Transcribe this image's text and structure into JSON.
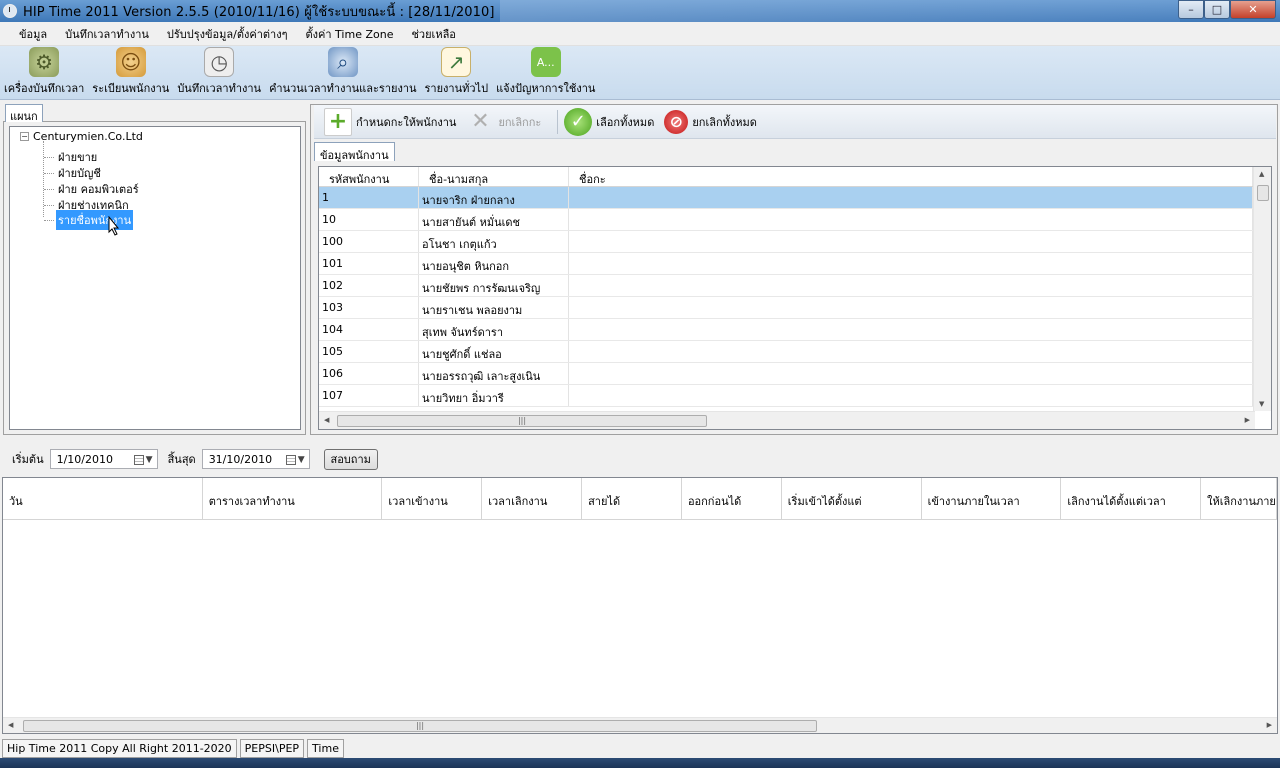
{
  "window": {
    "title": "HIP Time 2011 Version 2.5.5 (2010/11/16)   ผู้ใช้ระบบขณะนี้  :  [28/11/2010]",
    "controls": [
      "minimize",
      "maximize",
      "close"
    ]
  },
  "menu": [
    "ข้อมูล",
    "บันทึกเวลาทำงาน",
    "ปรับปรุงข้อมูล/ตั้งค่าต่างๆ",
    "ตั้งค่า Time Zone",
    "ช่วยเหลือ"
  ],
  "toolbar": [
    {
      "label": "เครื่องบันทึกเวลา",
      "icon": "gears-icon",
      "color": "#8a9b5a"
    },
    {
      "label": "ระเบียนพนักงาน",
      "icon": "users-icon",
      "color": "#d49a3a"
    },
    {
      "label": "บันทึกเวลาทำงาน",
      "icon": "calendar-clock-icon",
      "color": "#c9c9c9"
    },
    {
      "label": "คำนวนเวลาทำงานและรายงาน",
      "icon": "magnifier-icon",
      "color": "#6f95c4"
    },
    {
      "label": "รายงานทั่วไป",
      "icon": "chart-report-icon",
      "color": "#d9c27a"
    },
    {
      "label": "แจ้งปัญหาการใช้งาน",
      "icon": "chat-bubble-icon",
      "color": "#7cc24a"
    }
  ],
  "left_panel": {
    "tab": "แผนก",
    "root": "Centurymien.Co.Ltd",
    "children": [
      "ฝ่ายขาย",
      "ฝ่ายบัญชี",
      "ฝ่าย คอมพิวเตอร์",
      "ฝ่ายช่างเทคนิก",
      "รายชื่อพนักงาน"
    ],
    "selected": "รายชื่อพนักงาน"
  },
  "actions": {
    "assign": "กำหนดกะให้พนักงาน",
    "cancel_shift": "ยกเลิกกะ",
    "select_all": "เลือกทั้งหมด",
    "deselect_all": "ยกเลิกทั้งหมด"
  },
  "employee_tab": "ข้อมูลพนักงาน",
  "employee_grid": {
    "columns": [
      "รหัสพนักงาน",
      "ชื่อ-นามสกุล",
      "ชื่อกะ"
    ],
    "rows": [
      [
        "1",
        "นายจาริก ฝ่ายกลาง",
        ""
      ],
      [
        "10",
        "นายสายันต์ หมั่นเดช",
        ""
      ],
      [
        "100",
        "อโนชา เกตุแก้ว",
        ""
      ],
      [
        "101",
        "นายอนุชิต หินกอก",
        ""
      ],
      [
        "102",
        "นายชัยพร การรัฒนเจริญ",
        ""
      ],
      [
        "103",
        "นายราเชน พลอยงาม",
        ""
      ],
      [
        "104",
        "สุเทพ จันทร์ดารา",
        ""
      ],
      [
        "105",
        "นายชูศักดิ์ แช่ลอ",
        ""
      ],
      [
        "106",
        "นายอรรถวุฒิ เลาะสูงเนิน",
        ""
      ],
      [
        "107",
        "นายวิทยา อิ่มวารี",
        ""
      ]
    ],
    "selected_row": 0
  },
  "filter": {
    "start_label": "เริ่มต้น",
    "start_value": "1/10/2010",
    "end_label": "สิ้นสุด",
    "end_value": "31/10/2010",
    "query_button": "สอบถาม"
  },
  "time_grid": {
    "columns": [
      "วัน",
      "ตารางเวลาทำงาน",
      "เวลาเข้างาน",
      "เวลาเลิกงาน",
      "สายได้",
      "ออกก่อนได้",
      "เริ่มเข้าได้ตั้งแต่",
      "เข้างานภายในเวลา",
      "เลิกงานได้ตั้งแต่เวลา",
      "ให้เลิกงานภาย"
    ]
  },
  "status": [
    "Hip Time 2011 Copy All Right 2011-2020",
    "PEPSI\\PEP",
    "Time"
  ]
}
